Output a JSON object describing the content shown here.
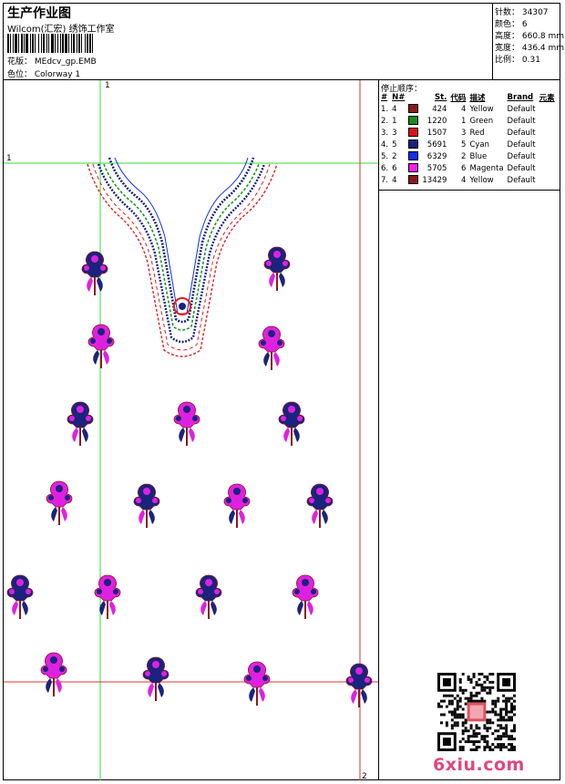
{
  "header": {
    "title": "生产作业图",
    "subtitle": "Wilcom(汇宏) 绣饰工作室",
    "design_file": "花版：  MEdcv_gp.EMB",
    "colorway": "色位：  Colorway 1"
  },
  "stats": [
    {
      "label": "针数：",
      "value": "34307"
    },
    {
      "label": "颜色：",
      "value": "6"
    },
    {
      "label": "高度：",
      "value": "660.8 mm"
    },
    {
      "label": "宽度：",
      "value": "436.4 mm"
    },
    {
      "label": "比例：",
      "value": "0.31"
    }
  ],
  "legend": {
    "heading": "停止顺序：",
    "columns": [
      "#",
      "N#",
      "",
      "St.",
      "代码",
      "描述",
      "Brand",
      "元素"
    ],
    "rows": [
      {
        "idx": "1.",
        "n": "4",
        "color": "#8b1a1a",
        "st": "424",
        "code": "4",
        "desc": "Yellow",
        "brand": "Default"
      },
      {
        "idx": "2.",
        "n": "1",
        "color": "#1a8c1a",
        "st": "1220",
        "code": "1",
        "desc": "Green",
        "brand": "Default"
      },
      {
        "idx": "3.",
        "n": "3",
        "color": "#e01010",
        "st": "1507",
        "code": "3",
        "desc": "Red",
        "brand": "Default"
      },
      {
        "idx": "4.",
        "n": "5",
        "color": "#1a237e",
        "st": "5691",
        "code": "5",
        "desc": "Cyan",
        "brand": "Default"
      },
      {
        "idx": "5.",
        "n": "2",
        "color": "#1030f0",
        "st": "6329",
        "code": "2",
        "desc": "Blue",
        "brand": "Default"
      },
      {
        "idx": "6.",
        "n": "6",
        "color": "#f020f0",
        "st": "5705",
        "code": "6",
        "desc": "Magenta",
        "brand": "Default"
      },
      {
        "idx": "7.",
        "n": "4",
        "color": "#8b1a1a",
        "st": "13429",
        "code": "4",
        "desc": "Yellow",
        "brand": "Default"
      }
    ]
  },
  "guides": {
    "label_a": "1",
    "label_b": "1",
    "label_c": "2"
  },
  "motifs": [
    {
      "pal": "blue"
    },
    {
      "pal": "blue"
    },
    {
      "pal": "pink"
    },
    {
      "pal": "pink"
    },
    {
      "pal": "blue"
    },
    {
      "pal": "pink"
    },
    {
      "pal": "blue"
    },
    {
      "pal": "pink"
    },
    {
      "pal": "blue"
    },
    {
      "pal": "pink"
    },
    {
      "pal": "blue"
    },
    {
      "pal": "blue"
    },
    {
      "pal": "pink"
    },
    {
      "pal": "blue"
    },
    {
      "pal": "pink"
    },
    {
      "pal": "pink"
    },
    {
      "pal": "blue"
    },
    {
      "pal": "pink"
    },
    {
      "pal": "blue"
    }
  ],
  "palettes": {
    "blue": {
      "main": "#1a237e",
      "accent": "#e020e0",
      "stem": "#8b1a1a"
    },
    "pink": {
      "main": "#e020e0",
      "accent": "#1a237e",
      "stem": "#8b1a1a"
    }
  },
  "watermark": "6xiu.com"
}
